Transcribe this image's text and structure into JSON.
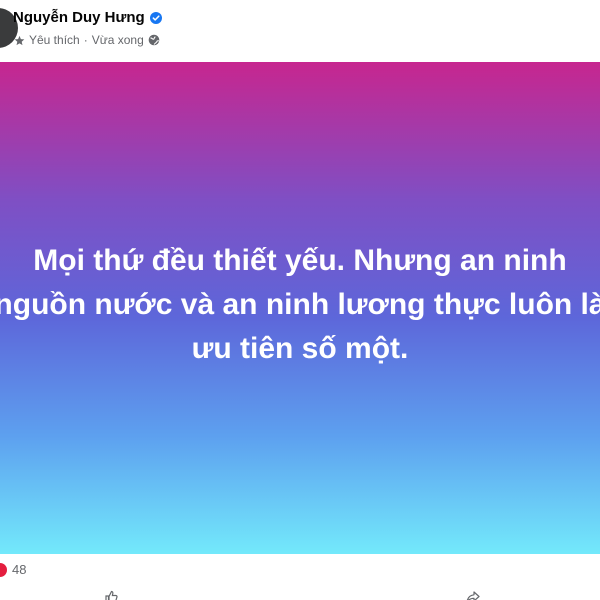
{
  "post": {
    "author": "Nguyễn Duy Hưng",
    "meta": {
      "favorite": "Yêu thích",
      "separator": "·",
      "time": "Vừa xong"
    },
    "text_lines": [
      "Mọi thứ đều thiết yếu. Nhưng an ninh",
      "nguồn nước và an ninh lương thực luôn là",
      "ưu tiên số một."
    ],
    "reaction_count": "48",
    "background_gradient": [
      "#c7268f",
      "#7f4fc4",
      "#5d67da",
      "#5da0ef",
      "#73e9fb"
    ]
  },
  "icons": {
    "verified": "verified-badge-icon",
    "favorite": "star-icon",
    "audience": "globe-icon",
    "reaction": "heart-reaction-icon"
  },
  "colors": {
    "verified": "#1877f2",
    "meta_text": "#65676b",
    "reaction": "#e41e3f"
  }
}
